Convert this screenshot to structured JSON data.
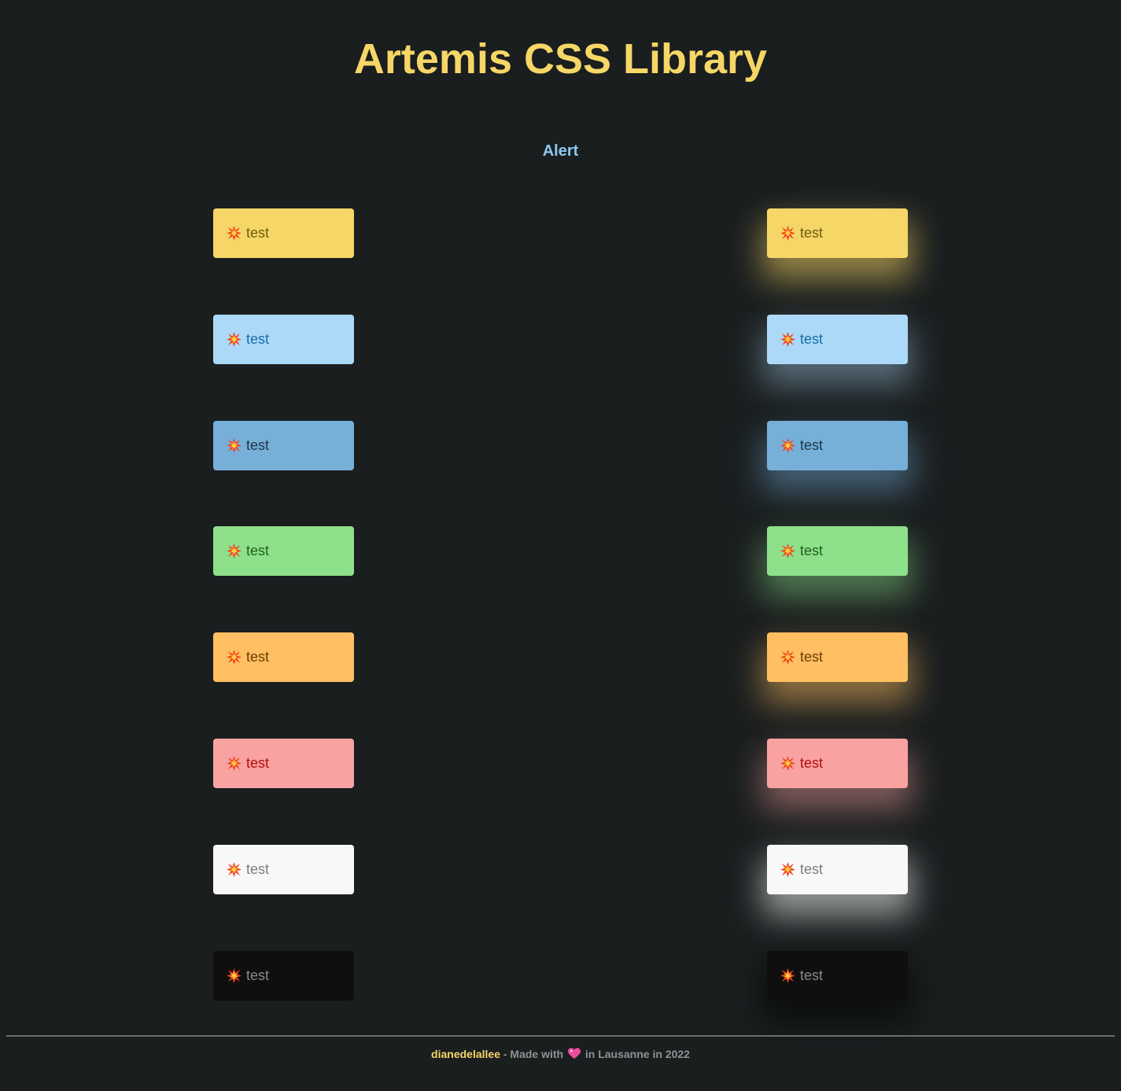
{
  "page": {
    "title": "Artemis CSS Library",
    "section_title": "Alert"
  },
  "alerts": {
    "icon": "collision-icon",
    "items": [
      {
        "variant": "yellow",
        "text": "test",
        "bg": "#f6d666",
        "fg": "#6e5b10",
        "glow": "rgba(246,214,102,0.55)"
      },
      {
        "variant": "light-blue",
        "text": "test",
        "bg": "#acd9f7",
        "fg": "#176ea8",
        "glow": "rgba(172,217,247,0.40)"
      },
      {
        "variant": "blue",
        "text": "test",
        "bg": "#76b0d9",
        "fg": "#1d3447",
        "glow": "rgba(118,176,217,0.45)"
      },
      {
        "variant": "green",
        "text": "test",
        "bg": "#8fe08b",
        "fg": "#1f5f1c",
        "glow": "rgba(143,224,139,0.45)"
      },
      {
        "variant": "orange",
        "text": "test",
        "bg": "#ffbf62",
        "fg": "#6a3e05",
        "glow": "rgba(255,191,98,0.50)"
      },
      {
        "variant": "red",
        "text": "test",
        "bg": "#f8a2a1",
        "fg": "#b10f0f",
        "glow": "rgba(248,162,161,0.45)"
      },
      {
        "variant": "white",
        "text": "test",
        "bg": "#f8f8f8",
        "fg": "#7d7d7d",
        "glow": "rgba(248,248,248,0.55)"
      },
      {
        "variant": "black",
        "text": "test",
        "bg": "#0f0f0f",
        "fg": "#8a8a8a",
        "glow": "rgba(0,0,0,0.55)"
      }
    ]
  },
  "footer": {
    "author": "dianedelallee",
    "made_with": "- Made with",
    "heart_icon": "sparkling-heart-icon",
    "location_text": "in Lausanne in 2022"
  }
}
